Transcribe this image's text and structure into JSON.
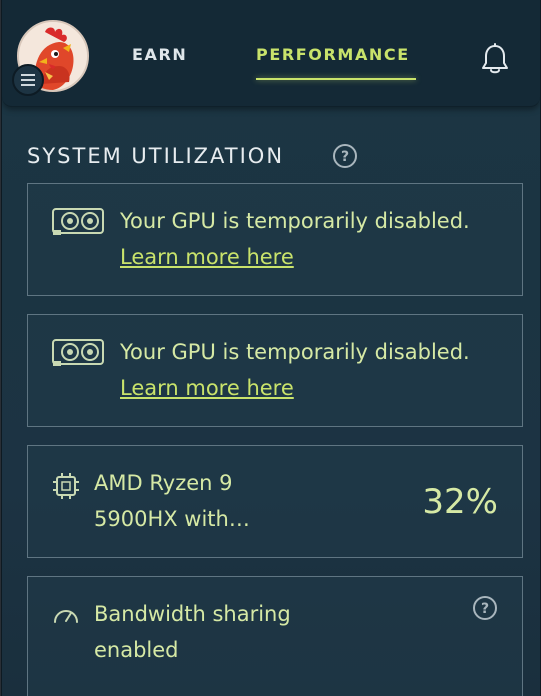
{
  "nav": {
    "earn_label": "EARN",
    "performance_label": "PERFORMANCE"
  },
  "section": {
    "title": "SYSTEM UTILIZATION"
  },
  "cards": [
    {
      "text": "Your GPU is temporarily disabled.",
      "link": "Learn more here",
      "icon": "gpu-icon"
    },
    {
      "text": "Your GPU is temporarily disabled.",
      "link": "Learn more here",
      "icon": "gpu-icon"
    },
    {
      "line1": "AMD Ryzen 9",
      "line2": "5900HX with…",
      "percent": "32%",
      "icon": "cpu-chip-icon"
    },
    {
      "line1": "Bandwidth sharing",
      "line2": "enabled",
      "icon": "gauge-icon"
    }
  ],
  "colors": {
    "accent": "#c9e36b",
    "text": "#d6e9a5",
    "background": "#1b3442"
  }
}
